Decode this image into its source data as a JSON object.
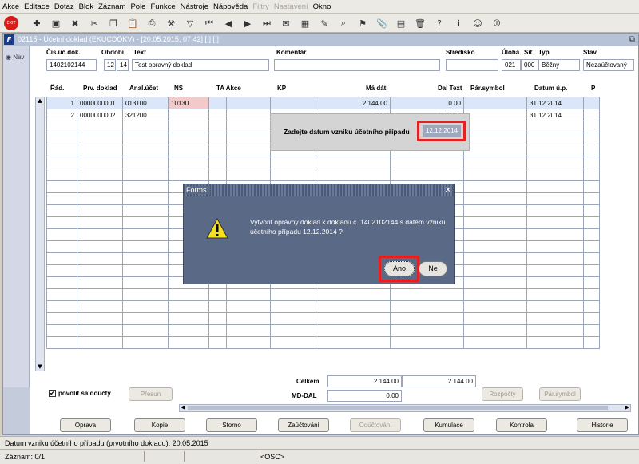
{
  "menu": [
    "Akce",
    "Editace",
    "Dotaz",
    "Blok",
    "Záznam",
    "Pole",
    "Funkce",
    "Nástroje",
    "Nápověda",
    "Filtry",
    "Nastavení",
    "Okno"
  ],
  "menu_disabled": [
    "Filtry",
    "Nastavení"
  ],
  "toolbar": {
    "exit_label": "EXIT",
    "icons": [
      "exit-icon",
      "new-record-icon",
      "save-record-icon",
      "delete-record-icon",
      "cut-icon",
      "copy-icon",
      "paste-icon",
      "print-icon",
      "tools-icon",
      "filter-icon",
      "first-record-icon",
      "prev-record-icon",
      "next-record-icon",
      "last-record-icon",
      "email-icon",
      "calculator-icon",
      "magic-icon",
      "query-icon",
      "flag-icon",
      "attach-icon",
      "calendar-icon",
      "trash-icon",
      "help-icon",
      "info-icon",
      "users-icon",
      "power-icon"
    ]
  },
  "window": {
    "title": "02115 - Účetní doklad (EKUCDOKV) - [20.05.2015, 07:42] [ ] [ ]",
    "nav": "Nav"
  },
  "header": {
    "labels": {
      "cis": "Čís.úč.dok.",
      "obdobi": "Období",
      "text": "Text",
      "komentar": "Komentář",
      "stredisko": "Středisko",
      "uloha": "Úloha",
      "sit": "Síť",
      "typ": "Typ",
      "stav": "Stav"
    },
    "values": {
      "cis": "1402102144",
      "obdobi_year": "12",
      "obdobi_month": "14",
      "text": "Test opravný doklad",
      "komentar": "",
      "stredisko": "",
      "uloha": "021",
      "sit": "000",
      "typ": "Běžný",
      "stav": "Nezaúčtovaný"
    }
  },
  "table": {
    "columns": [
      "Řád.",
      "Prv. doklad",
      "Anal.účet",
      "NS",
      "TA Akce",
      "KP",
      "Má dáti",
      "Dal Text",
      "Pár.symbol",
      "Datum ú.p.",
      "P"
    ],
    "rows": [
      {
        "rad": "1",
        "prv": "0000000001",
        "anal": "013100",
        "ns": "10130",
        "ma_dati": "2 144.00",
        "dal": "0.00",
        "datum": "31.12.2014"
      },
      {
        "rad": "2",
        "prv": "0000000002",
        "anal": "321200",
        "ns": "",
        "ma_dati": "0.00",
        "dal": "2 144.00",
        "datum": "31.12.2014"
      }
    ]
  },
  "totals": {
    "celkem_label": "Celkem",
    "celkem_ma": "2 144.00",
    "celkem_dal": "2 144.00",
    "mddal_label": "MD-DAL",
    "mddal": "0.00"
  },
  "saldo": {
    "label": "povolit saldoúčty",
    "checked": true,
    "presun": "Přesun",
    "rozpocty": "Rozpočty",
    "par_symbol": "Pár.symbol"
  },
  "buttons": [
    "Oprava",
    "Kopie",
    "Storno",
    "Zaúčtování",
    "Odúčtování",
    "Kumulace",
    "Kontrola",
    "Historie"
  ],
  "buttons_disabled": [
    "Odúčtování"
  ],
  "popup": {
    "label": "Zadejte datum vzniku účetního případu",
    "value": "12.12.2014"
  },
  "dialog": {
    "title": "Forms",
    "message": "Vytvořit opravný doklad k dokladu č. 1402102144 s datem vzniku účetního případu 12.12.2014 ?",
    "yes": "Ano",
    "no": "Ne"
  },
  "status": {
    "line1": "Datum vzniku účetního případu (prvotního dokladu): 20.05.2015",
    "record": "Záznam: 0/1",
    "osc": "<OSC>"
  },
  "colors": {
    "highlight": "#e52020",
    "dialog_bg": "#5a6a86",
    "selected_row": "#dbe7f8",
    "ns_cell": "#f2caca"
  }
}
